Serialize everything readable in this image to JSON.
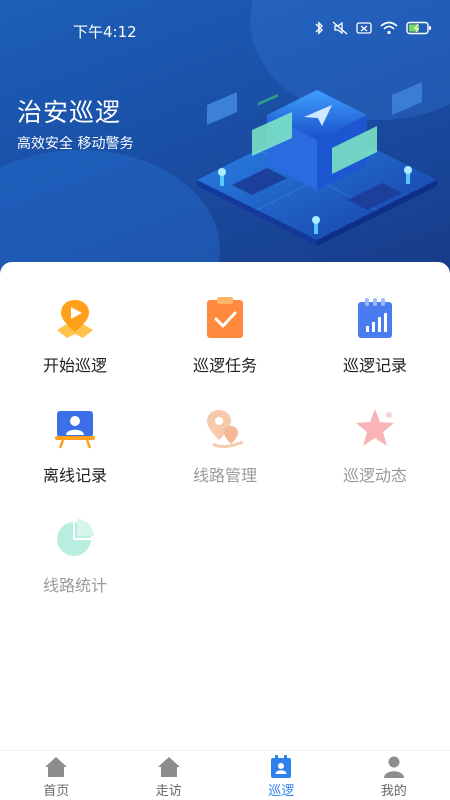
{
  "status_bar": {
    "time": "下午4:12",
    "battery_color": "#7ed957"
  },
  "hero": {
    "title": "治安巡逻",
    "subtitle": "高效安全  移动警务"
  },
  "menu": [
    {
      "label": "开始巡逻",
      "icon": "start-patrol-icon",
      "enabled": true
    },
    {
      "label": "巡逻任务",
      "icon": "clipboard-check-icon",
      "enabled": true
    },
    {
      "label": "巡逻记录",
      "icon": "bar-chart-calendar-icon",
      "enabled": true
    },
    {
      "label": "离线记录",
      "icon": "person-board-icon",
      "enabled": true
    },
    {
      "label": "线路管理",
      "icon": "route-pin-icon",
      "enabled": false
    },
    {
      "label": "巡逻动态",
      "icon": "star-icon",
      "enabled": false
    },
    {
      "label": "线路统计",
      "icon": "pie-chart-icon",
      "enabled": false
    }
  ],
  "tabbar": [
    {
      "label": "首页",
      "icon": "home-icon"
    },
    {
      "label": "走访",
      "icon": "home-icon"
    },
    {
      "label": "巡逻",
      "icon": "patrol-badge-icon",
      "active": true
    },
    {
      "label": "我的",
      "icon": "user-icon"
    }
  ],
  "colors": {
    "primary": "#2f80ed",
    "hero_bg": "#1a4fa6",
    "disabled_text": "#9a9a9a"
  }
}
